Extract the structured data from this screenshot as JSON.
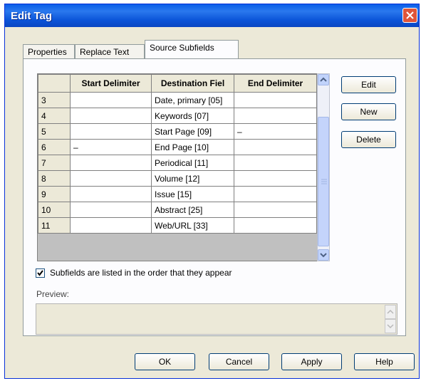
{
  "window": {
    "title": "Edit Tag"
  },
  "tabs": [
    {
      "label": "Properties"
    },
    {
      "label": "Replace Text"
    },
    {
      "label": "Source Subfields"
    }
  ],
  "grid": {
    "columns": [
      "",
      "Start Delimiter",
      "Destination Fiel",
      "End Delimiter"
    ],
    "rows": [
      {
        "num": "3",
        "start": "",
        "dest": "Date, primary [05]",
        "end": ""
      },
      {
        "num": "4",
        "start": "",
        "dest": "Keywords [07]",
        "end": ""
      },
      {
        "num": "5",
        "start": "",
        "dest": "Start Page [09]",
        "end": "–"
      },
      {
        "num": "6",
        "start": "–",
        "dest": "End Page [10]",
        "end": ""
      },
      {
        "num": "7",
        "start": "",
        "dest": "Periodical [11]",
        "end": ""
      },
      {
        "num": "8",
        "start": "",
        "dest": "Volume [12]",
        "end": ""
      },
      {
        "num": "9",
        "start": "",
        "dest": "Issue [15]",
        "end": ""
      },
      {
        "num": "10",
        "start": "",
        "dest": "Abstract [25]",
        "end": ""
      },
      {
        "num": "11",
        "start": "",
        "dest": "Web/URL [33]",
        "end": ""
      }
    ]
  },
  "side_buttons": {
    "edit": "Edit",
    "new": "New",
    "delete": "Delete"
  },
  "checkbox": {
    "label": "Subfields are listed in the order that they appear",
    "checked": true
  },
  "preview": {
    "label": "Preview:",
    "value": ""
  },
  "bottom_buttons": {
    "ok": "OK",
    "cancel": "Cancel",
    "apply": "Apply",
    "help": "Help"
  },
  "colors": {
    "titlebar": "#0a5ee8",
    "close": "#e0553a",
    "dialog": "#ece9d8"
  }
}
